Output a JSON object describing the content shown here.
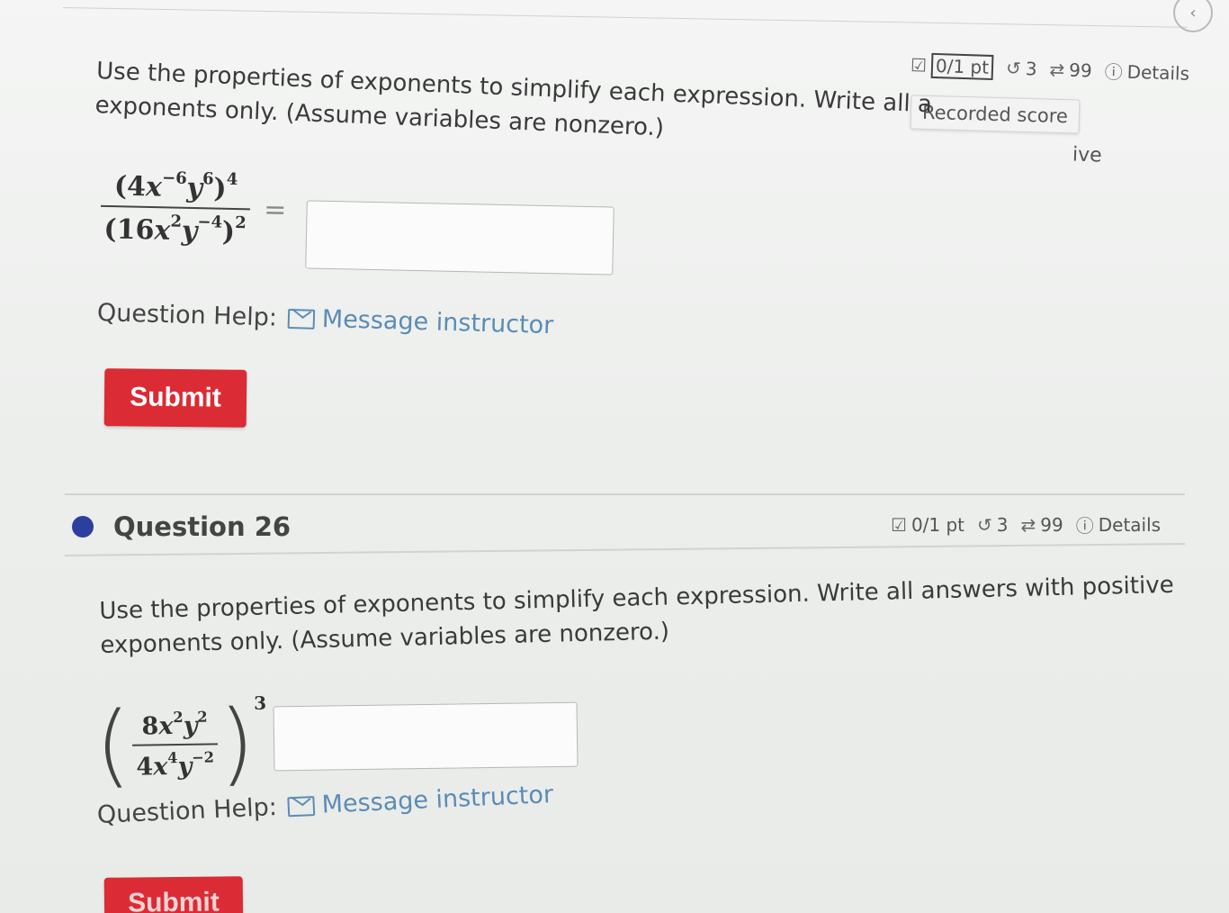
{
  "q25": {
    "meta": {
      "points": "0/1 pt",
      "attempts": "3",
      "tries": "99",
      "details": "Details"
    },
    "tooltip": "Recorded score",
    "prompt_line1": "Use the properties of exponents to simplify each expression. Write all a",
    "prompt_line1_tail": "ive",
    "prompt_line2": "exponents only. (Assume variables are nonzero.)",
    "expression": {
      "num_coef": "(4",
      "num_var1": "x",
      "num_exp1": "−6",
      "num_var2": "y",
      "num_exp2": "6",
      "num_close": ")",
      "num_outer_exp": "4",
      "den_coef": "(16",
      "den_var1": "x",
      "den_exp1": "2",
      "den_var2": "y",
      "den_exp2": "−4",
      "den_close": ")",
      "den_outer_exp": "2",
      "equals": "="
    },
    "help_label": "Question Help:",
    "help_link": "Message instructor",
    "submit_label": "Submit"
  },
  "q26": {
    "title": "Question 26",
    "meta": {
      "points": "0/1 pt",
      "attempts": "3",
      "tries": "99",
      "details": "Details"
    },
    "prompt_line1": "Use the properties of exponents to simplify each expression. Write all answers with positive",
    "prompt_line2": "exponents only. (Assume variables are nonzero.)",
    "expression": {
      "num_coef": "8",
      "num_var1": "x",
      "num_exp1": "2",
      "num_var2": "y",
      "num_exp2": "2",
      "den_coef": "4",
      "den_var1": "x",
      "den_exp1": "4",
      "den_var2": "y",
      "den_exp2": "−2",
      "outer_exp": "3",
      "open_paren": "(",
      "close_paren": ")"
    },
    "help_label": "Question Help:",
    "help_link": "Message instructor",
    "submit_label": "Submit"
  },
  "icons": {
    "checkbox": "☑",
    "retry": "↺",
    "repeat": "⇄",
    "info": "ⓘ",
    "back": "‹"
  },
  "colors": {
    "submit": "#db2b34",
    "link": "#5b8cb5",
    "question_dot": "#2c3e9e"
  }
}
